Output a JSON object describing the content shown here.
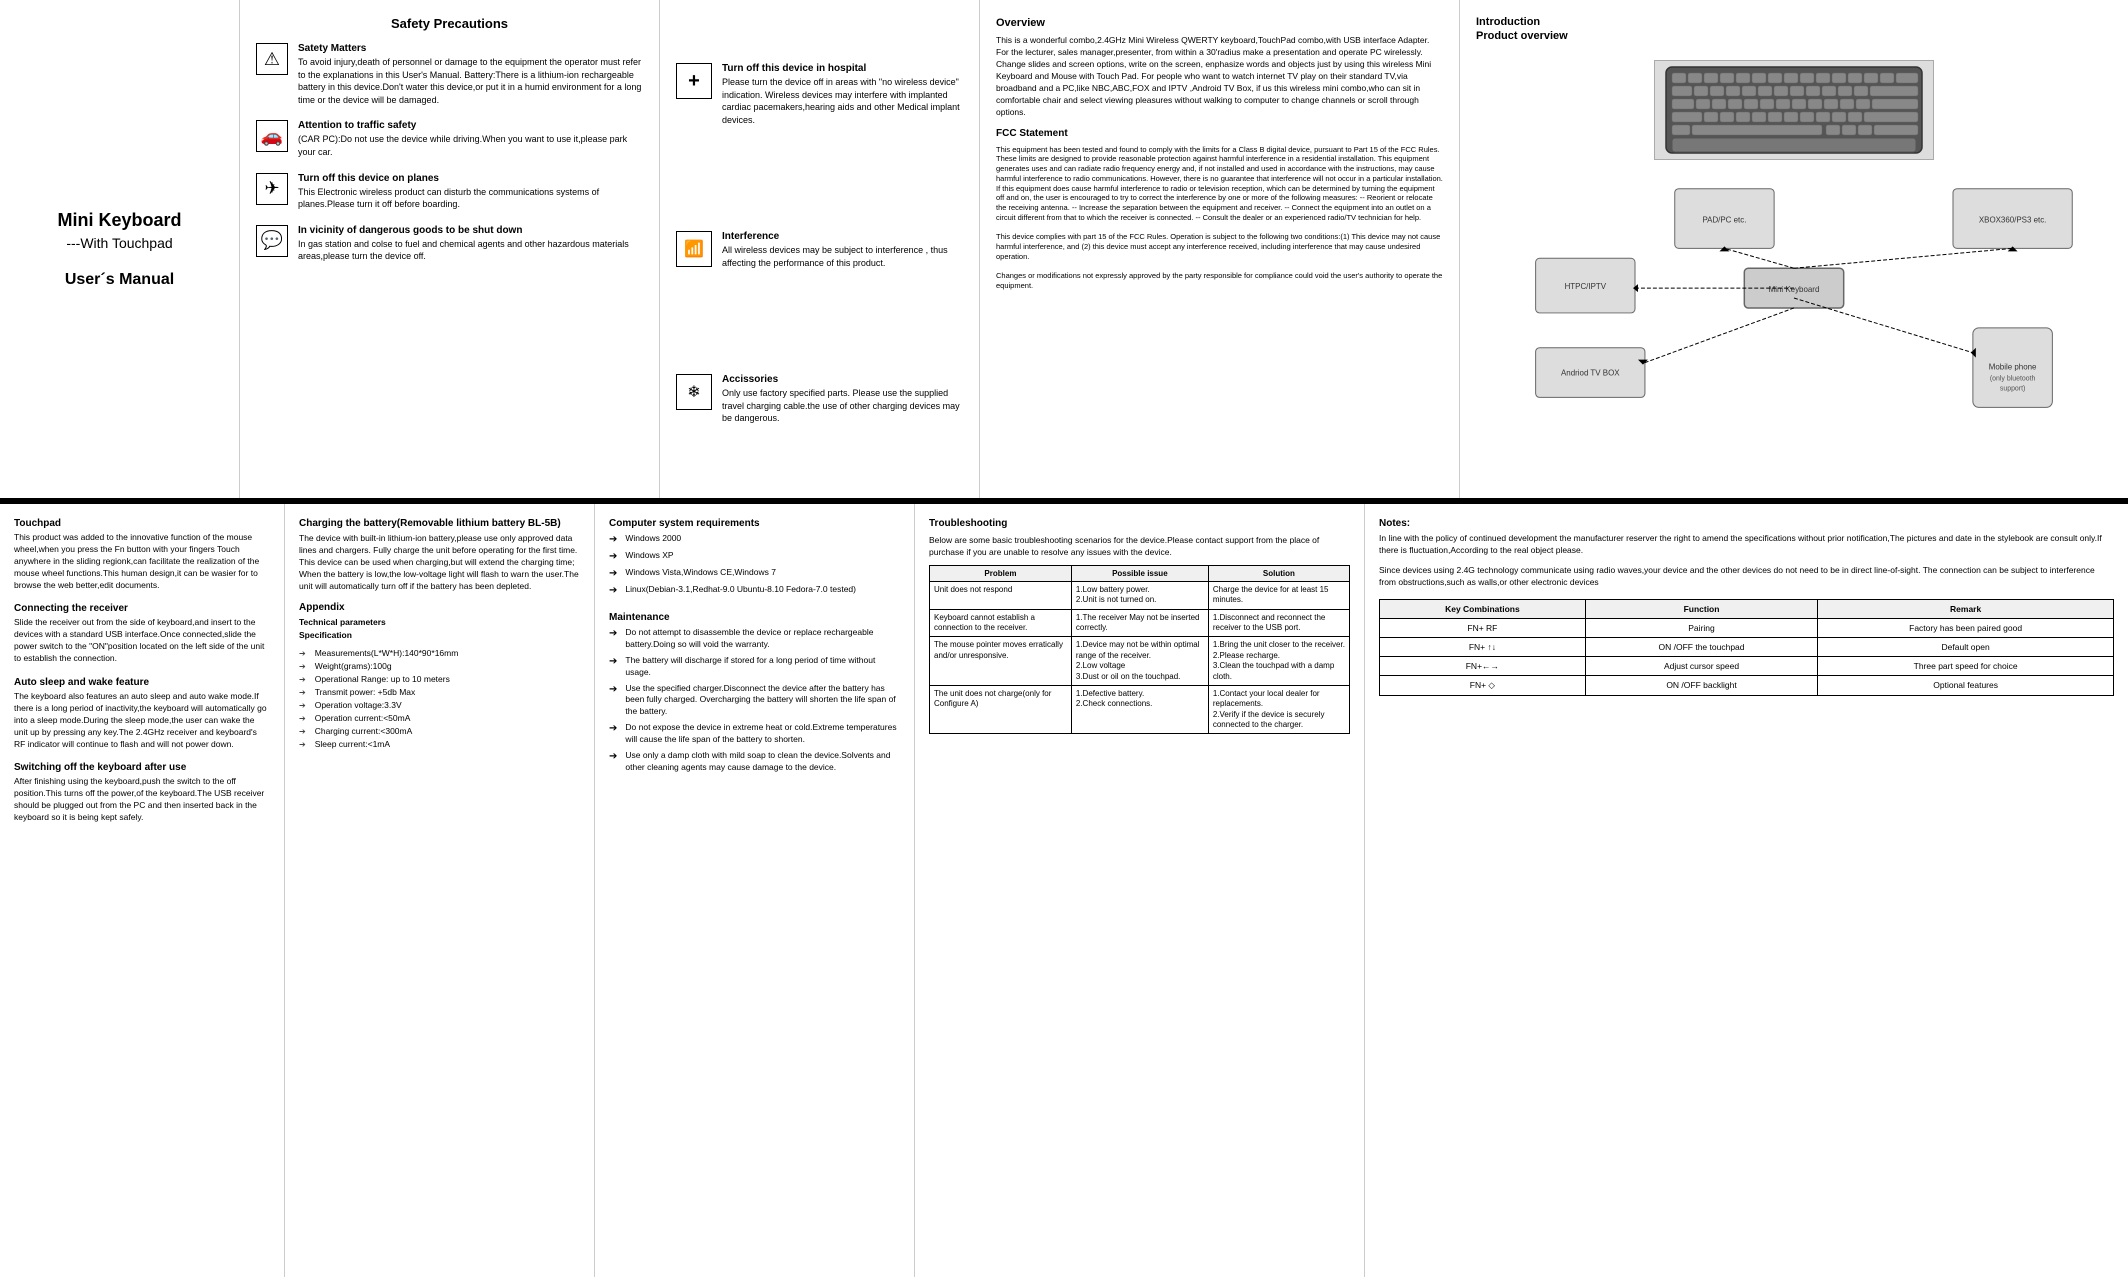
{
  "title": {
    "main": "Mini  Keyboard",
    "sub": "---With Touchpad",
    "manual": "User´s Manual"
  },
  "safety": {
    "heading": "Safety Precautions",
    "items": [
      {
        "icon": "⚠",
        "title": "Satety Matters",
        "text": "To avoid injury,death of personnel or damage to the equipment the operator must refer to the explanations in this User's Manual. Battery:There is a lithium-ion rechargeable battery in this device.Don't water this device,or put it in a humid environment for a long time or the device will be damaged."
      },
      {
        "icon": "🚗",
        "title": "Attention to traffic safety",
        "text": "(CAR PC):Do not use the device while driving.When you want to use it,please park your car."
      },
      {
        "icon": "✈",
        "title": "Turn off this device on planes",
        "text": "This Electronic wireless product can disturb the communications systems of planes.Please turn it off  before boarding."
      },
      {
        "icon": "⚠",
        "title": "In vicinity of dangerous goods to be shut down",
        "text": "In gas station and colse to fuel and chemical agents and other hazardous materials areas,please turn the device off."
      }
    ]
  },
  "notices": {
    "items": [
      {
        "icon": "+",
        "title": "Turn off this device in hospital",
        "text": "Please turn the device off in areas with \"no wireless device\" indication. Wireless devices may interfere with implanted cardiac pacemakers,hearing aids and other Medical implant devices."
      },
      {
        "icon": "📶",
        "title": "Interference",
        "text": "All wireless devices may be subject to interference , thus affecting the performance of this product."
      },
      {
        "icon": "🔌",
        "title": "Accissories",
        "text": "Only use factory specified parts. Please use the supplied travel charging cable.the use of other charging devices may be dangerous."
      }
    ]
  },
  "overview": {
    "heading": "Overview",
    "text": "This is a wonderful combo,2.4GHz Mini Wireless QWERTY keyboard,TouchPad combo,with USB interface Adapter. For the lecturer, sales manager,presenter, from within a 30'radius make a presentation and operate PC wirelessly. Change slides and screen options, write on the screen, enphasize words and objects just by using this wireless Mini Keyboard and Mouse with Touch Pad. For people who want to watch internet TV play on their standard TV,via broadband and a PC,like NBC,ABC,FOX and IPTV ,Android TV Box, if us this wireless mini combo,who can sit in comfortable chair and select viewing pleasures without walking to computer to change channels or scroll through options.",
    "fcc_title": "FCC Statement",
    "fcc_text": "This equipment has been tested and found to comply with the limits for a Class B digital device, pursuant to Part 15 of the FCC Rules. These limits are designed to provide reasonable protection against harmful interference in a residential installation. This equipment generates uses and can radiate radio frequency energy and, if not installed and used in accordance with the instructions, may cause harmful interference to radio communications. However, there is no guarantee that interference will not occur in a particular installation. If this equipment does cause harmful interference to radio or television reception, which can be determined by turning the equipment off and on, the user is encouraged to try to correct the interference by one or more of the following measures: -- Reorient or relocate the receiving antenna. -- Increase the separation between the equipment and receiver. -- Connect the equipment into an outlet on a circuit different from that to which the receiver is connected. -- Consult the dealer or an experienced radio/TV technician for help.\n\nThis device complies with part 15 of the FCC Rules. Operation is subject to the following two conditions:(1) This device may not cause harmful interference, and (2) this device must accept any interference received, including interference that may cause undesired operation.\n\nChanges or modifications not expressly approved by the party responsible for compliance could void the user's authority to operate the equipment."
  },
  "introduction": {
    "heading": "Introduction",
    "subheading": "Product overview",
    "devices": [
      {
        "label": "XBOX360/PS3 etc.",
        "size": "large"
      },
      {
        "label": "HTPC/IPTV",
        "size": "medium"
      },
      {
        "label": "PAD/PC etc.",
        "size": "medium"
      },
      {
        "label": "Andriod TV BOX",
        "size": "medium"
      },
      {
        "label": "Mobile phone\n(only bluetooth support)",
        "size": "small"
      }
    ]
  },
  "touchpad": {
    "heading": "Touchpad",
    "text": "This product was added to the innovative function of the mouse wheel,when you press the Fn button with your fingers Touch anywhere in the sliding regionk,can facilitate the realization of the mouse wheel functions.This human design,it can be wasier for to browse the web better,edit documents."
  },
  "connecting": {
    "heading": "Connecting the receiver",
    "text": "Slide the receiver out from the side of keyboard,and insert to the devices with a standard USB interface.Once connected,slide the power switch to the \"ON\"position located on the left side of the unit to establish the connection."
  },
  "auto_sleep": {
    "heading": "Auto sleep and wake feature",
    "text": "The keyboard also features an auto sleep and auto wake mode.If there is a long period of inactivity,the keyboard will automatically go into a sleep mode.During the sleep mode,the user can wake the unit up by pressing any key.The 2.4GHz receiver and keyboard's RF indicator will continue to flash and will not power down."
  },
  "switching": {
    "heading": "Switching off the keyboard after use",
    "text": "After finishing using the keyboard,push the switch to the off position.This turns off the power,of the keyboard.The USB receiver should be plugged out from the PC and then inserted back in the keyboard so it is being kept safely."
  },
  "charging": {
    "heading": "Charging the battery(Removable lithium battery BL-5B)",
    "text": "The device with built-in lithium-ion battery,please use only approved data lines and chargers. Fully charge the unit before operating for the first time. This device can be used when charging,but will extend the charging time; When the battery is low,the low-voltage light will flash to warn the user.The unit will automatically turn off if the battery has been depleted."
  },
  "appendix": {
    "heading": "Appendix",
    "subheading": "Technical parameters",
    "subheading2": "Specification",
    "specs": [
      "Measurements(L*W*H):140*90*16mm",
      "Weight(grams):100g",
      "Operational Range: up to 10 meters",
      "Transmit power: +5db Max",
      "Operation voltage:3.3V",
      "Operation current:<50mA",
      "Charging current:<300mA",
      "Sleep current:<1mA"
    ]
  },
  "computer_req": {
    "heading": "Computer system requirements",
    "items": [
      "Windows 2000",
      "Windows XP",
      "Windows Vista,Windows CE,Windows 7",
      "Linux(Debian-3.1,Redhat-9.0 Ubuntu-8.10 Fedora-7.0 tested)"
    ]
  },
  "maintenance": {
    "heading": "Maintenance",
    "items": [
      "Do not attempt to disassemble the device or replace rechargeable battery.Doing so will void the warranty.",
      "The battery will discharge if stored for a long period of time without usage.",
      "Use the specified charger.Disconnect the device after the battery has been fully charged. Overcharging the battery will shorten the life span of the battery.",
      "Do not expose the device in extreme heat or cold.Extreme temperatures will cause the life span of the battery to shorten.",
      "Use only a damp cloth with mild soap to clean the device.Solvents and other cleaning agents may cause damage to the device."
    ]
  },
  "troubleshooting": {
    "heading": "Troubleshooting",
    "intro": "Below are some basic troubleshooting scenarios for the device.Please contact support from the place of purchase if you are unable to resolve any issues with the device.",
    "columns": [
      "Problem",
      "Possible issue",
      "Solution"
    ],
    "rows": [
      {
        "problem": "Unit does not respond",
        "possible": "1.Low battery power.\n2.Unit is not turned on.",
        "solution": "Charge the device for at least 15 minutes."
      },
      {
        "problem": "Keyboard cannot establish a connection to the receiver.",
        "possible": "1.The receiver May not be inserted correctly.",
        "solution": "1.Disconnect and reconnect the receiver to the USB port."
      },
      {
        "problem": "The mouse pointer moves erratically and/or unresponsive.",
        "possible": "1.Device may not be within optimal range of the receiver.\n2.Low voltage\n3.Dust or oil on the touchpad.",
        "solution": "1.Bring the unit closer to the receiver.\n2.Please recharge.\n3.Clean the touchpad with a damp cloth."
      },
      {
        "problem": "The unit does not charge(only for Configure A)",
        "possible": "1.Defective battery.\n2.Check connections.",
        "solution": "1.Contact your local dealer for replacements.\n2.Verify if the device is securely connected to the charger."
      }
    ]
  },
  "notes": {
    "heading": "Notes:",
    "paragraphs": [
      "In line with the policy of continued development the manufacturer reserver the right to amend the specifications without prior notification,The pictures and date in the stylebook are consult only.If there is fluctuation,According to the real object please.",
      "Since devices using 2.4G technology communicate using radio waves,your device and the other devices do not need to be in direct line-of-sight. The connection can be subject to interference from obstructions,such as walls,or other electronic devices"
    ]
  },
  "key_combinations": {
    "heading": "Key Combinations",
    "columns": [
      "Key Combinations",
      "Function",
      "Remark"
    ],
    "rows": [
      {
        "combo": "FN+ RF",
        "function": "Pairing",
        "remark": "Factory has been paired good"
      },
      {
        "combo": "FN+ ↑↓",
        "function": "ON /OFF the touchpad",
        "remark": "Default open"
      },
      {
        "combo": "FN+←→",
        "function": "Adjust cursor speed",
        "remark": "Three part speed for choice"
      },
      {
        "combo": "FN+ ◇",
        "function": "ON /OFF backlight",
        "remark": "Optional features"
      }
    ]
  }
}
